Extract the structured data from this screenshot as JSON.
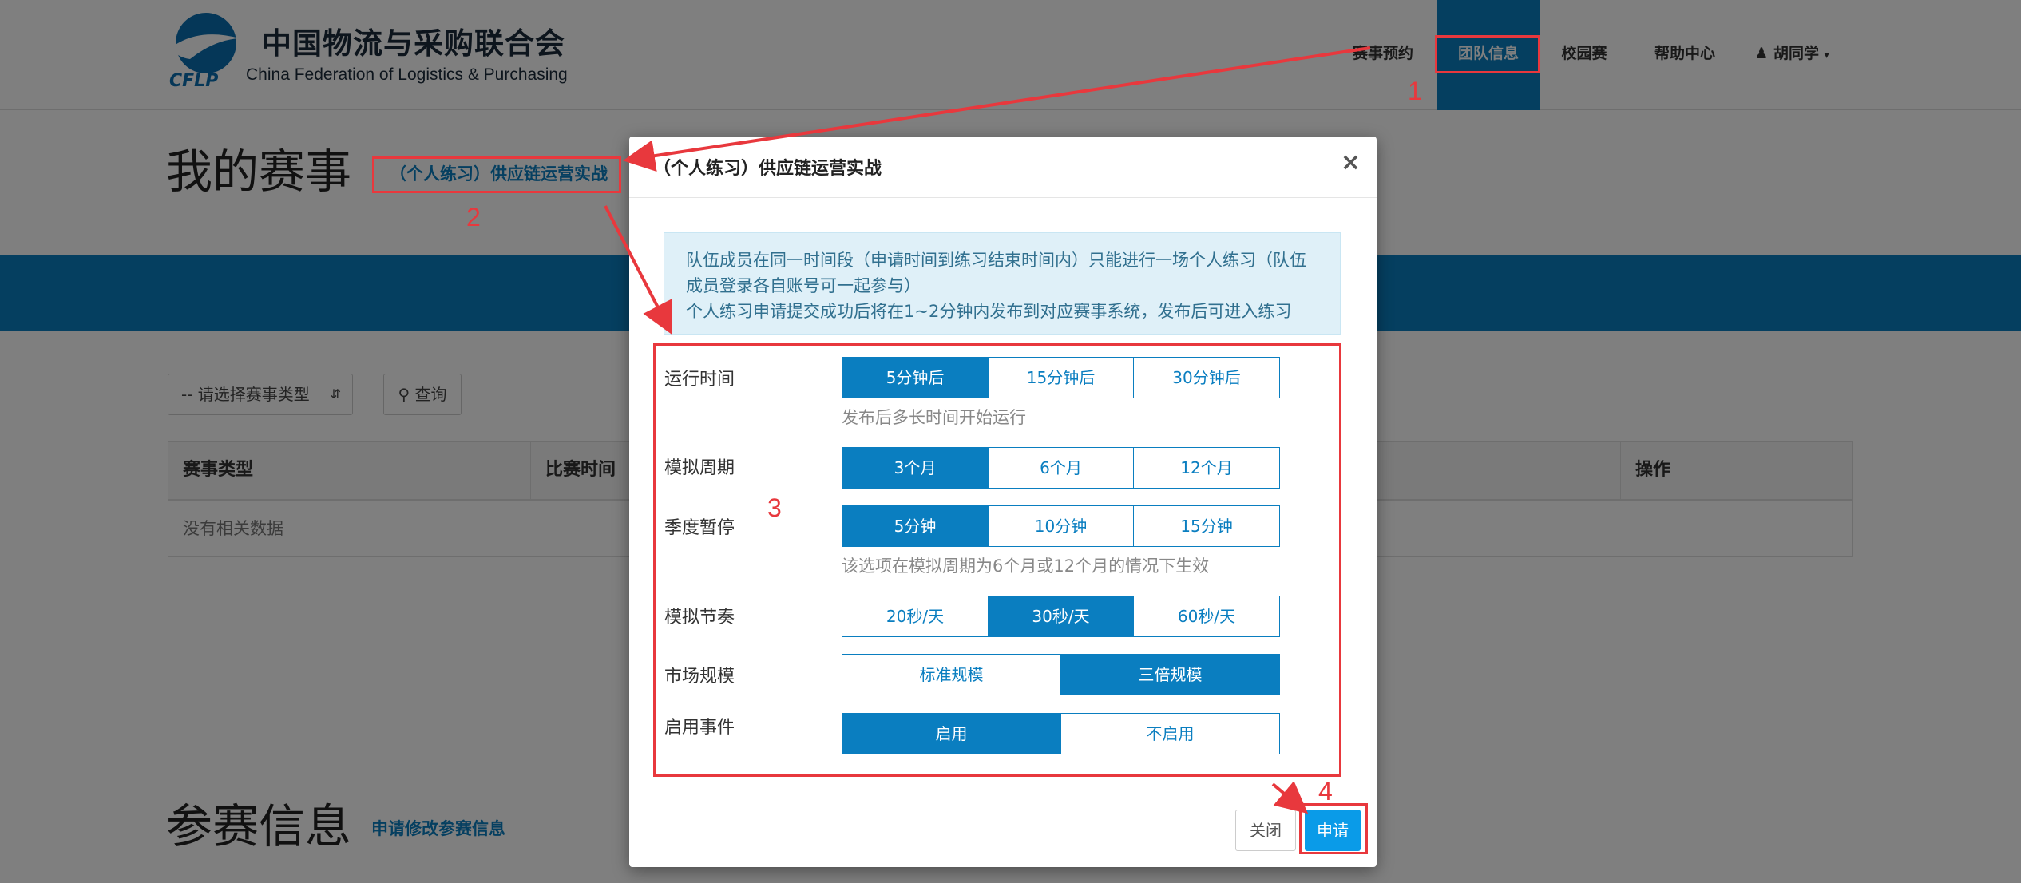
{
  "brand": {
    "name_cn": "中国物流与采购联合会",
    "name_en": "China Federation of Logistics & Purchasing",
    "abbr": "CFLP"
  },
  "nav": {
    "items": [
      {
        "label": "赛事预约"
      },
      {
        "label": "团队信息"
      },
      {
        "label": "校园赛"
      },
      {
        "label": "帮助中心"
      }
    ],
    "user": "胡同学"
  },
  "page": {
    "title": "我的赛事",
    "title_link": "（个人练习）供应链运营实战",
    "filter_placeholder": "-- 请选择赛事类型",
    "query_button": "查询",
    "table": {
      "headers": [
        "赛事类型",
        "比赛时间",
        "操作"
      ],
      "empty": "没有相关数据"
    },
    "section_title": "参赛信息",
    "section_link": "申请修改参赛信息"
  },
  "modal": {
    "title": "（个人练习）供应链运营实战",
    "close_symbol": "×",
    "notice": [
      "队伍成员在同一时间段（申请时间到练习结束时间内）只能进行一场个人练习（队伍成员登录各自账号可一起参与）",
      "个人练习申请提交成功后将在1~2分钟内发布到对应赛事系统，发布后可进入练习"
    ],
    "fields": {
      "run_time": {
        "label": "运行时间",
        "options": [
          "5分钟后",
          "15分钟后",
          "30分钟后"
        ],
        "selected": 0,
        "help": "发布后多长时间开始运行"
      },
      "period": {
        "label": "模拟周期",
        "options": [
          "3个月",
          "6个月",
          "12个月"
        ],
        "selected": 0
      },
      "pause": {
        "label": "季度暂停",
        "options": [
          "5分钟",
          "10分钟",
          "15分钟"
        ],
        "selected": 0,
        "help": "该选项在模拟周期为6个月或12个月的情况下生效"
      },
      "rhythm": {
        "label": "模拟节奏",
        "options": [
          "20秒/天",
          "30秒/天",
          "60秒/天"
        ],
        "selected": 1
      },
      "scale": {
        "label": "市场规模",
        "options": [
          "标准规模",
          "三倍规模"
        ],
        "selected": 1
      },
      "events": {
        "label": "启用事件",
        "options": [
          "启用",
          "不启用"
        ],
        "selected": 0
      }
    },
    "footer": {
      "close": "关闭",
      "apply": "申请"
    }
  },
  "annotations": {
    "labels": [
      "1",
      "2",
      "3",
      "4"
    ],
    "color": "#e8383d"
  },
  "colors": {
    "primary": "#0a7ec0",
    "apply": "#0a9be8",
    "annotation": "#e8383d"
  }
}
